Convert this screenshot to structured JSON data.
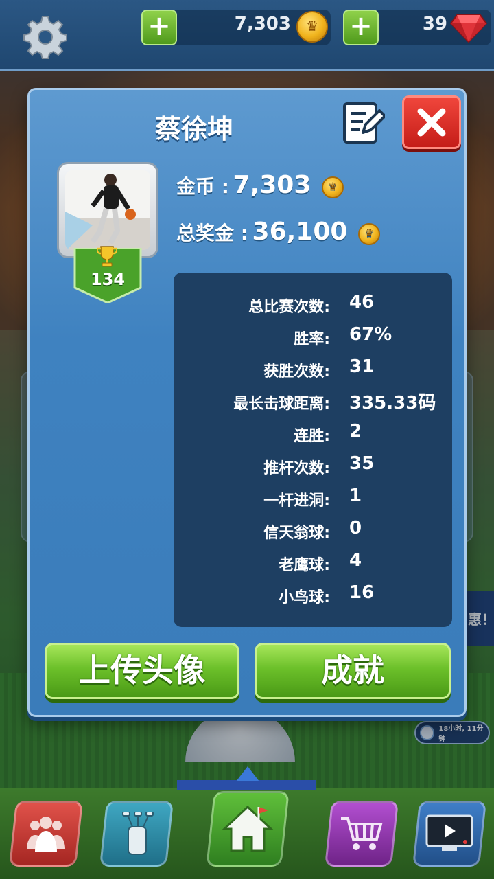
{
  "topbar": {
    "coins_value": "7,303",
    "gems_value": "39",
    "plus_label": "+"
  },
  "profile": {
    "name": "蔡徐坤",
    "level": "134",
    "coins_label": "金币 :",
    "coins_value": "7,303",
    "prize_label": "总奖金 :",
    "prize_value": "36,100"
  },
  "stats": [
    {
      "label": "总比赛次数:",
      "value": "46"
    },
    {
      "label": "胜率:",
      "value": "67%"
    },
    {
      "label": "获胜次数:",
      "value": "31"
    },
    {
      "label": "最长击球距离:",
      "value": "335.33码"
    },
    {
      "label": "连胜:",
      "value": "2"
    },
    {
      "label": "推杆次数:",
      "value": "35"
    },
    {
      "label": "一杆进洞:",
      "value": "1"
    },
    {
      "label": "信天翁球:",
      "value": "0"
    },
    {
      "label": "老鹰球:",
      "value": "4"
    },
    {
      "label": "小鸟球:",
      "value": "16"
    }
  ],
  "buttons": {
    "upload_avatar": "上传头像",
    "achievements": "成就"
  },
  "background": {
    "timer_text": "18小时, 11分钟",
    "promo_text": "惠！"
  },
  "colors": {
    "accent_green": "#6cc02a",
    "close_red": "#e0352c",
    "panel_blue": "#3f82c0",
    "stats_bg": "#1e3f62"
  },
  "icons": {
    "settings": "gear-icon",
    "coin": "crown-coin-icon",
    "gem": "ruby-gem-icon",
    "edit": "edit-note-icon",
    "close": "close-x-icon",
    "trophy": "trophy-icon",
    "nav": [
      "social-icon",
      "golf-bag-icon",
      "home-icon",
      "shop-cart-icon",
      "tv-replay-icon"
    ]
  }
}
